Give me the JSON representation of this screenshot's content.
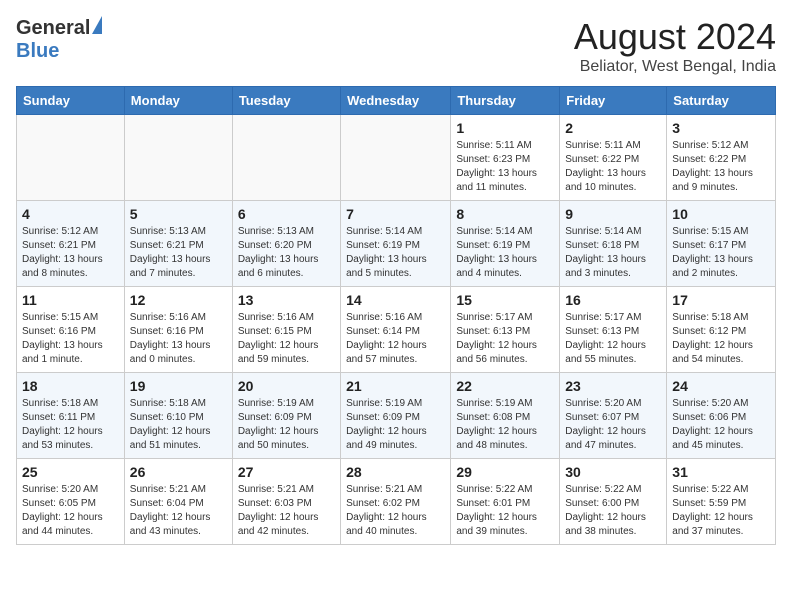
{
  "header": {
    "logo_general": "General",
    "logo_blue": "Blue",
    "month_title": "August 2024",
    "location": "Beliator, West Bengal, India"
  },
  "days_of_week": [
    "Sunday",
    "Monday",
    "Tuesday",
    "Wednesday",
    "Thursday",
    "Friday",
    "Saturday"
  ],
  "weeks": [
    [
      {
        "day": "",
        "info": ""
      },
      {
        "day": "",
        "info": ""
      },
      {
        "day": "",
        "info": ""
      },
      {
        "day": "",
        "info": ""
      },
      {
        "day": "1",
        "info": "Sunrise: 5:11 AM\nSunset: 6:23 PM\nDaylight: 13 hours\nand 11 minutes."
      },
      {
        "day": "2",
        "info": "Sunrise: 5:11 AM\nSunset: 6:22 PM\nDaylight: 13 hours\nand 10 minutes."
      },
      {
        "day": "3",
        "info": "Sunrise: 5:12 AM\nSunset: 6:22 PM\nDaylight: 13 hours\nand 9 minutes."
      }
    ],
    [
      {
        "day": "4",
        "info": "Sunrise: 5:12 AM\nSunset: 6:21 PM\nDaylight: 13 hours\nand 8 minutes."
      },
      {
        "day": "5",
        "info": "Sunrise: 5:13 AM\nSunset: 6:21 PM\nDaylight: 13 hours\nand 7 minutes."
      },
      {
        "day": "6",
        "info": "Sunrise: 5:13 AM\nSunset: 6:20 PM\nDaylight: 13 hours\nand 6 minutes."
      },
      {
        "day": "7",
        "info": "Sunrise: 5:14 AM\nSunset: 6:19 PM\nDaylight: 13 hours\nand 5 minutes."
      },
      {
        "day": "8",
        "info": "Sunrise: 5:14 AM\nSunset: 6:19 PM\nDaylight: 13 hours\nand 4 minutes."
      },
      {
        "day": "9",
        "info": "Sunrise: 5:14 AM\nSunset: 6:18 PM\nDaylight: 13 hours\nand 3 minutes."
      },
      {
        "day": "10",
        "info": "Sunrise: 5:15 AM\nSunset: 6:17 PM\nDaylight: 13 hours\nand 2 minutes."
      }
    ],
    [
      {
        "day": "11",
        "info": "Sunrise: 5:15 AM\nSunset: 6:16 PM\nDaylight: 13 hours\nand 1 minute."
      },
      {
        "day": "12",
        "info": "Sunrise: 5:16 AM\nSunset: 6:16 PM\nDaylight: 13 hours\nand 0 minutes."
      },
      {
        "day": "13",
        "info": "Sunrise: 5:16 AM\nSunset: 6:15 PM\nDaylight: 12 hours\nand 59 minutes."
      },
      {
        "day": "14",
        "info": "Sunrise: 5:16 AM\nSunset: 6:14 PM\nDaylight: 12 hours\nand 57 minutes."
      },
      {
        "day": "15",
        "info": "Sunrise: 5:17 AM\nSunset: 6:13 PM\nDaylight: 12 hours\nand 56 minutes."
      },
      {
        "day": "16",
        "info": "Sunrise: 5:17 AM\nSunset: 6:13 PM\nDaylight: 12 hours\nand 55 minutes."
      },
      {
        "day": "17",
        "info": "Sunrise: 5:18 AM\nSunset: 6:12 PM\nDaylight: 12 hours\nand 54 minutes."
      }
    ],
    [
      {
        "day": "18",
        "info": "Sunrise: 5:18 AM\nSunset: 6:11 PM\nDaylight: 12 hours\nand 53 minutes."
      },
      {
        "day": "19",
        "info": "Sunrise: 5:18 AM\nSunset: 6:10 PM\nDaylight: 12 hours\nand 51 minutes."
      },
      {
        "day": "20",
        "info": "Sunrise: 5:19 AM\nSunset: 6:09 PM\nDaylight: 12 hours\nand 50 minutes."
      },
      {
        "day": "21",
        "info": "Sunrise: 5:19 AM\nSunset: 6:09 PM\nDaylight: 12 hours\nand 49 minutes."
      },
      {
        "day": "22",
        "info": "Sunrise: 5:19 AM\nSunset: 6:08 PM\nDaylight: 12 hours\nand 48 minutes."
      },
      {
        "day": "23",
        "info": "Sunrise: 5:20 AM\nSunset: 6:07 PM\nDaylight: 12 hours\nand 47 minutes."
      },
      {
        "day": "24",
        "info": "Sunrise: 5:20 AM\nSunset: 6:06 PM\nDaylight: 12 hours\nand 45 minutes."
      }
    ],
    [
      {
        "day": "25",
        "info": "Sunrise: 5:20 AM\nSunset: 6:05 PM\nDaylight: 12 hours\nand 44 minutes."
      },
      {
        "day": "26",
        "info": "Sunrise: 5:21 AM\nSunset: 6:04 PM\nDaylight: 12 hours\nand 43 minutes."
      },
      {
        "day": "27",
        "info": "Sunrise: 5:21 AM\nSunset: 6:03 PM\nDaylight: 12 hours\nand 42 minutes."
      },
      {
        "day": "28",
        "info": "Sunrise: 5:21 AM\nSunset: 6:02 PM\nDaylight: 12 hours\nand 40 minutes."
      },
      {
        "day": "29",
        "info": "Sunrise: 5:22 AM\nSunset: 6:01 PM\nDaylight: 12 hours\nand 39 minutes."
      },
      {
        "day": "30",
        "info": "Sunrise: 5:22 AM\nSunset: 6:00 PM\nDaylight: 12 hours\nand 38 minutes."
      },
      {
        "day": "31",
        "info": "Sunrise: 5:22 AM\nSunset: 5:59 PM\nDaylight: 12 hours\nand 37 minutes."
      }
    ]
  ]
}
